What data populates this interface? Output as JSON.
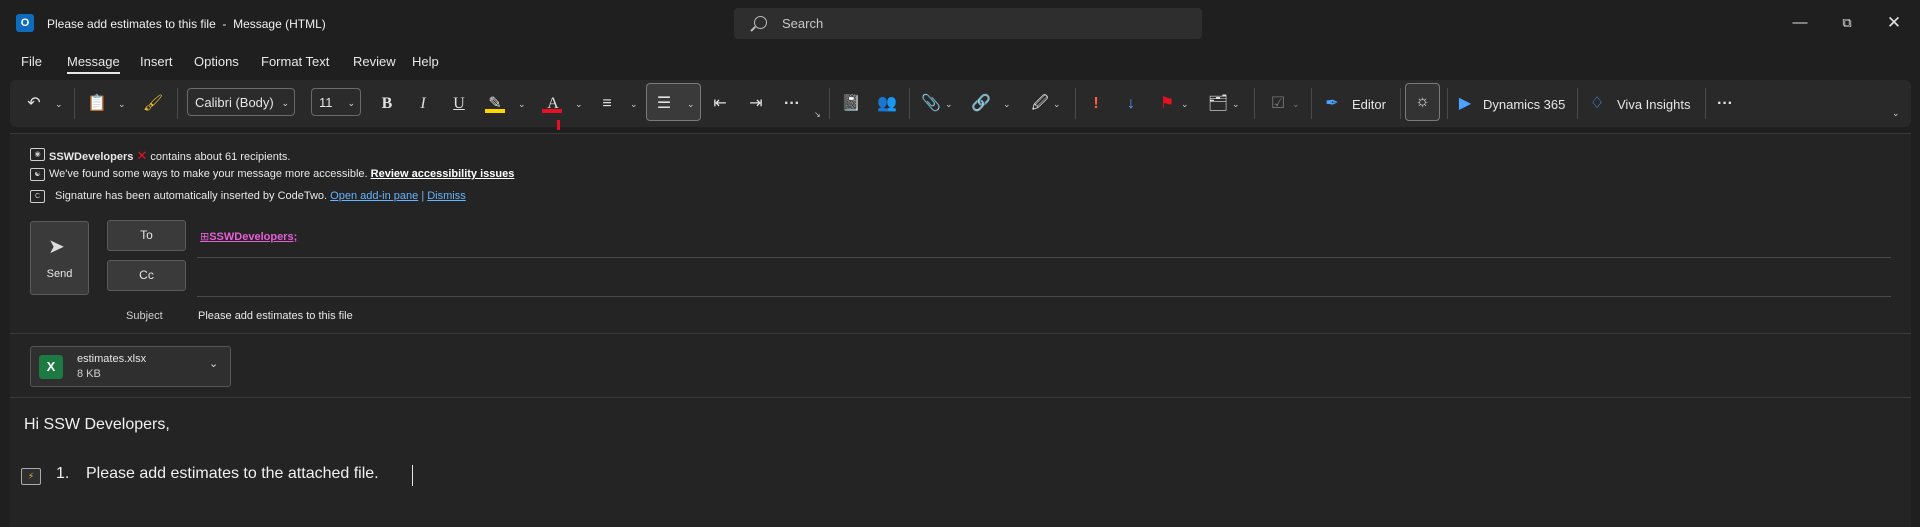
{
  "window": {
    "app_icon": "outlook-icon",
    "title": "Please add estimates to this file  -  Message (HTML)",
    "search_placeholder": "Search",
    "controls": [
      "minimize-icon",
      "restore-icon",
      "close-icon"
    ]
  },
  "menu": {
    "tabs": [
      "File",
      "Message",
      "Insert",
      "Options",
      "Format Text",
      "Review",
      "Help"
    ],
    "active": "Message"
  },
  "ribbon": {
    "font_name": "Calibri (Body)",
    "font_size": "11",
    "bold": "B",
    "italic": "I",
    "underline": "U",
    "font_color_letter": "A",
    "more": "···",
    "editor_label": "Editor",
    "dynamics_label": "Dynamics 365",
    "viva_label": "Viva Insights",
    "colors": {
      "highlight": "#ffd600",
      "font_color": "#e81123",
      "importance_high": "#ff5d3a",
      "flag": "#e81123",
      "accent": "#4ca3ff"
    }
  },
  "info_bar": {
    "recipients_group": "SSWDevelopers",
    "recipients_text": "contains about 61 recipients.",
    "accessibility_text": "We've found some ways to make your message more accessible.",
    "accessibility_link": "Review accessibility issues",
    "signature_text": "Signature has been automatically inserted by CodeTwo.",
    "signature_link": "Open add-in pane",
    "signature_sep": "|",
    "signature_dismiss": "Dismiss"
  },
  "compose": {
    "send_label": "Send",
    "to_label": "To",
    "cc_label": "Cc",
    "to_value": "SSWDevelopers;",
    "to_expand": "⊞",
    "subject_label": "Subject",
    "subject_value": "Please add estimates to this file"
  },
  "attachment": {
    "name": "estimates.xlsx",
    "size": "8 KB",
    "icon": "excel-icon"
  },
  "body": {
    "greeting": "Hi SSW Developers,",
    "list_number": "1.",
    "list_text": "Please add estimates to the attached file."
  }
}
